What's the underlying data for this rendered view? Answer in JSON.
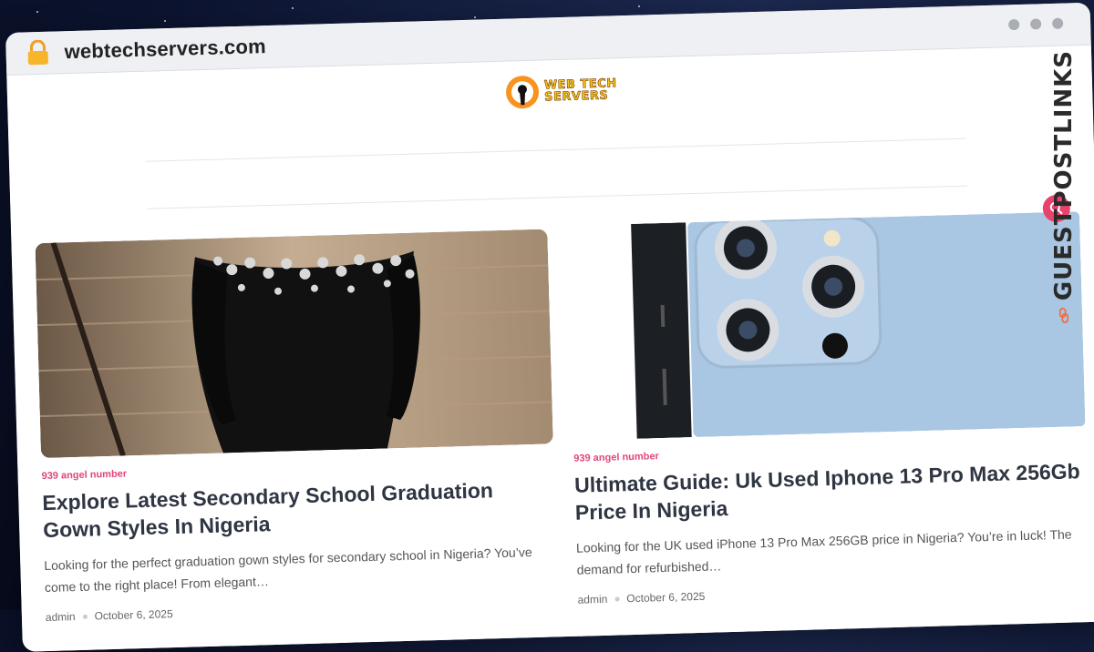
{
  "browser": {
    "url": "webtechservers.com"
  },
  "site": {
    "logo_line1": "WEB TECH",
    "logo_line2": "SERVERS"
  },
  "posts": [
    {
      "category": "939 angel number",
      "title": "Explore Latest Secondary School Graduation Gown Styles In Nigeria",
      "excerpt": "Looking for the perfect graduation gown styles for secondary school in Nigeria? You’ve come to the right place! From elegant…",
      "author": "admin",
      "date": "October 6, 2025"
    },
    {
      "category": "939 angel number",
      "title": "Ultimate Guide: Uk Used Iphone 13 Pro Max 256Gb Price In Nigeria",
      "excerpt": "Looking for the UK used iPhone 13 Pro Max 256GB price in Nigeria? You’re in luck! The demand for refurbished…",
      "author": "admin",
      "date": "October 6, 2025"
    }
  ],
  "badge": {
    "text": "GUESTPOSTLINKS"
  },
  "colors": {
    "accent": "#e9426b",
    "badge_orange": "#f26a3d",
    "logo_orange": "#f7931e"
  }
}
